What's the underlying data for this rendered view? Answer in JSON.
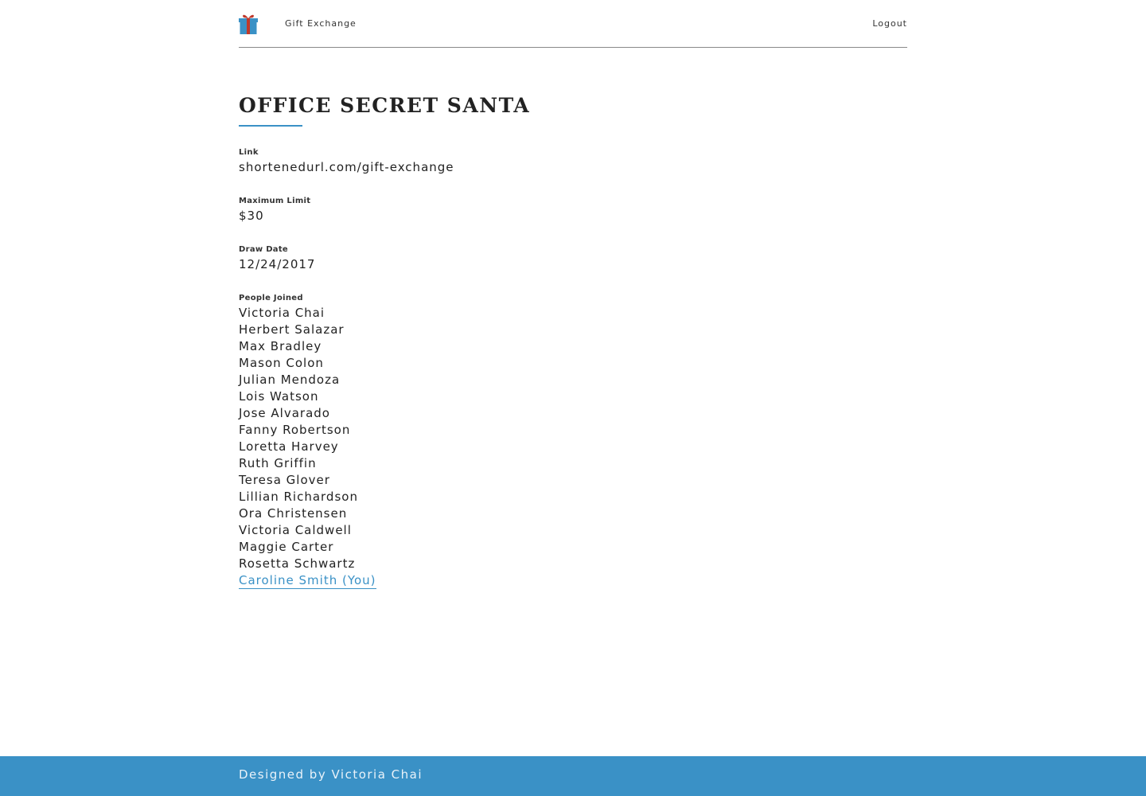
{
  "header": {
    "brand": "Gift Exchange",
    "logout": "Logout",
    "logo_icon": "gift-box-icon",
    "logo_colors": {
      "box": "#3a91c6",
      "ribbon": "#c0392b"
    }
  },
  "exchange": {
    "title": "OFFICE SECRET SANTA",
    "link_label": "Link",
    "link_value": "shortenedurl.com/gift-exchange",
    "limit_label": "Maximum Limit",
    "limit_value": "$30",
    "date_label": "Draw Date",
    "date_value": "12/24/2017",
    "people_label": "People Joined",
    "people": [
      "Victoria Chai",
      "Herbert Salazar",
      "Max Bradley",
      "Mason Colon",
      "Julian Mendoza",
      "Lois Watson",
      "Jose Alvarado",
      "Fanny Robertson",
      "Loretta Harvey",
      "Ruth Griffin",
      "Teresa Glover",
      "Lillian Richardson",
      "Ora Christensen",
      "Victoria Caldwell",
      "Maggie Carter",
      "Rosetta Schwartz"
    ],
    "current_user": "Caroline Smith (You)"
  },
  "footer": {
    "credit": "Designed by Victoria Chai"
  },
  "colors": {
    "accent": "#3a91c6",
    "text": "#222222"
  }
}
